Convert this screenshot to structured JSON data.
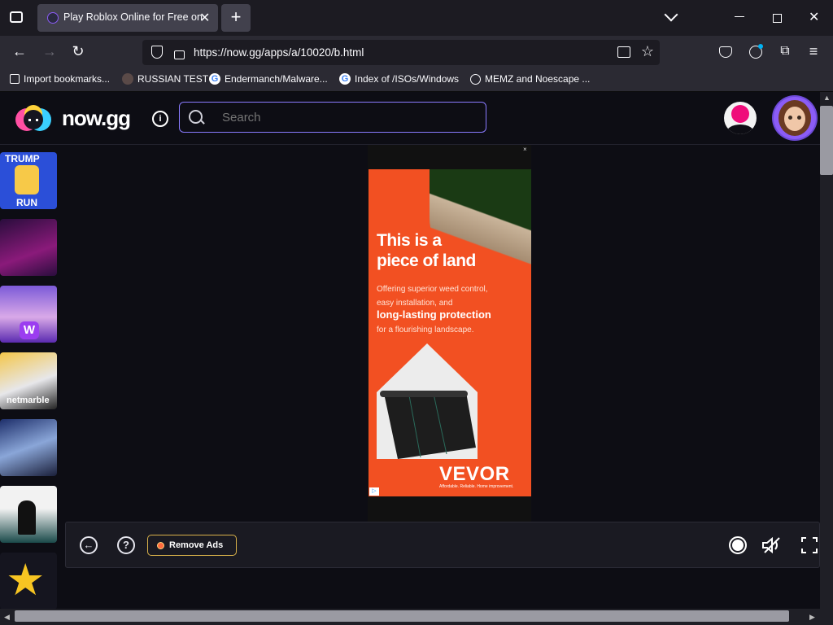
{
  "browser": {
    "tab_title": "Play Roblox Online for Free on PC",
    "tab_close": "✕",
    "new_tab": "+",
    "url": "https://now.gg/apps/a/10020/b.html",
    "bookmarks": [
      {
        "label": "Import bookmarks...",
        "icon": "import-icon"
      },
      {
        "label": "RUSSIAN TEST",
        "icon": "headphones-icon"
      },
      {
        "label": "Endermanch/Malware...",
        "icon": "google-icon"
      },
      {
        "label": "Index of /ISOs/Windows",
        "icon": "google-icon"
      },
      {
        "label": "MEMZ and Noescape ...",
        "icon": "globe-icon"
      }
    ]
  },
  "site": {
    "logo_text": "now.gg",
    "search_placeholder": "Search",
    "info_glyph": "i"
  },
  "sidebar": {
    "games": [
      {
        "name": "trump-run",
        "label_top": "TRUMP",
        "label_bottom": "RUN"
      },
      {
        "name": "anime-fighter"
      },
      {
        "name": "w-girl",
        "label_top": "W"
      },
      {
        "name": "netmarble",
        "label_bottom": "netmarble"
      },
      {
        "name": "dark-hero"
      },
      {
        "name": "shadow-fight"
      },
      {
        "name": "star-game"
      }
    ]
  },
  "ad": {
    "headline_1": "This is a",
    "headline_2": "piece of land",
    "body_1": "Offering superior weed control,",
    "body_2": "easy installation, and",
    "body_bold": "long-lasting protection",
    "body_3": "for a flourishing landscape.",
    "brand": "VEVOR",
    "tagline": "Affordable. Reliable. Home improvement.",
    "choices": "▷",
    "close": "×",
    "colors": {
      "background": "#f25022"
    }
  },
  "controls": {
    "back_glyph": "←",
    "help_glyph": "?",
    "remove_ads_label": "Remove Ads"
  }
}
